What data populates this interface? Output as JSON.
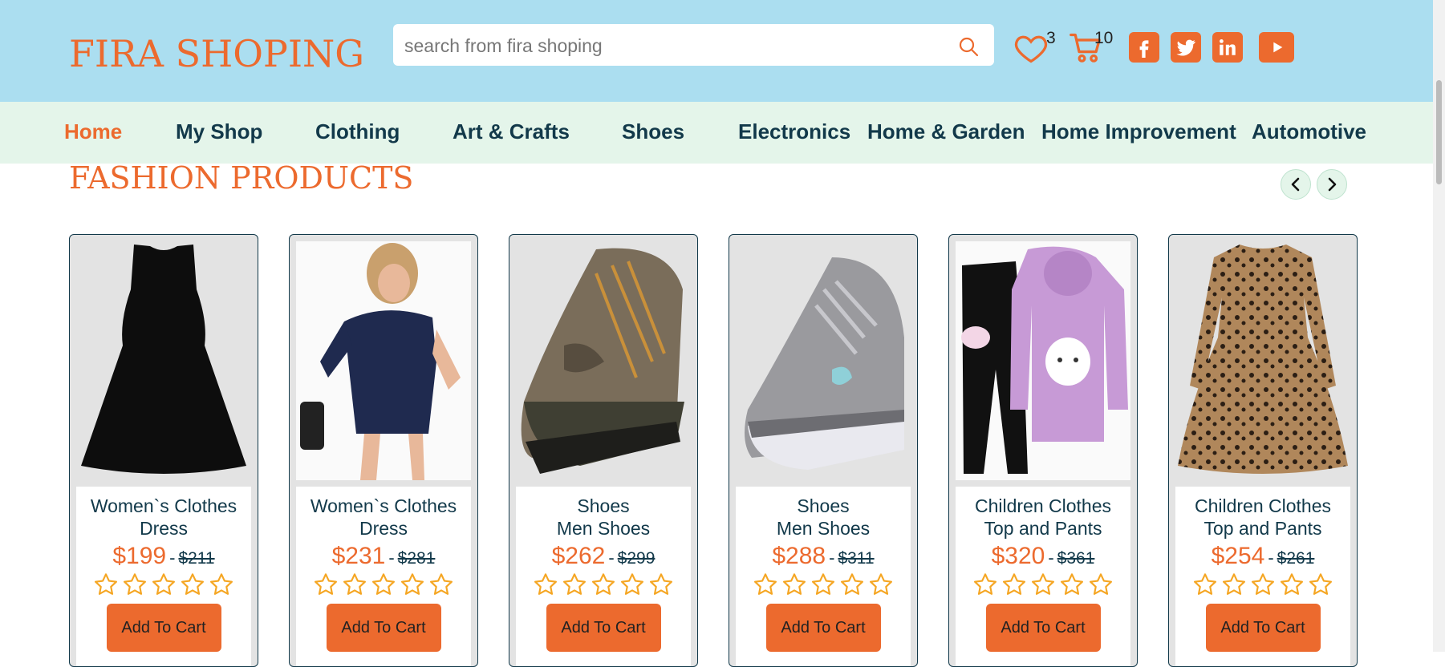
{
  "header": {
    "logo": "FIRA SHOPING",
    "search_placeholder": "search from fira shoping",
    "wishlist_count": "3",
    "cart_count": "10"
  },
  "nav": {
    "items": [
      "Home",
      "My Shop",
      "Clothing",
      "Art & Crafts",
      "Shoes",
      "Electronics",
      "Home & Garden",
      "Home Improvement",
      "Automotive"
    ],
    "active": "Home"
  },
  "section": {
    "title": "FASHION PRODUCTS"
  },
  "products": [
    {
      "line1": "Women`s Clothes",
      "line2": "Dress",
      "price": "$199",
      "old_price": "$211",
      "button": "Add To Cart",
      "image": "black-dress-image"
    },
    {
      "line1": "Women`s Clothes",
      "line2": "Dress",
      "price": "$231",
      "old_price": "$281",
      "button": "Add To Cart",
      "image": "navy-dress-image"
    },
    {
      "line1": "Shoes",
      "line2": "Men Shoes",
      "price": "$262",
      "old_price": "$299",
      "button": "Add To Cart",
      "image": "hiking-shoe-image"
    },
    {
      "line1": "Shoes",
      "line2": "Men Shoes",
      "price": "$288",
      "old_price": "$311",
      "button": "Add To Cart",
      "image": "sneaker-image"
    },
    {
      "line1": "Children Clothes",
      "line2": "Top and Pants",
      "price": "$320",
      "old_price": "$361",
      "button": "Add To Cart",
      "image": "hoodie-pants-image"
    },
    {
      "line1": "Children Clothes",
      "line2": "Top and Pants",
      "price": "$254",
      "old_price": "$261",
      "button": "Add To Cart",
      "image": "leopard-dress-image"
    }
  ],
  "colors": {
    "accent": "#ec6a2e",
    "header_bg": "#abdef0",
    "nav_bg": "#e4f5ea",
    "text_dark": "#12394a",
    "star": "#f5a623"
  },
  "icons": {
    "search": "search-icon",
    "wishlist": "heart-icon",
    "cart": "cart-icon",
    "social": [
      "facebook-icon",
      "twitter-icon",
      "linkedin-icon",
      "youtube-icon"
    ]
  }
}
